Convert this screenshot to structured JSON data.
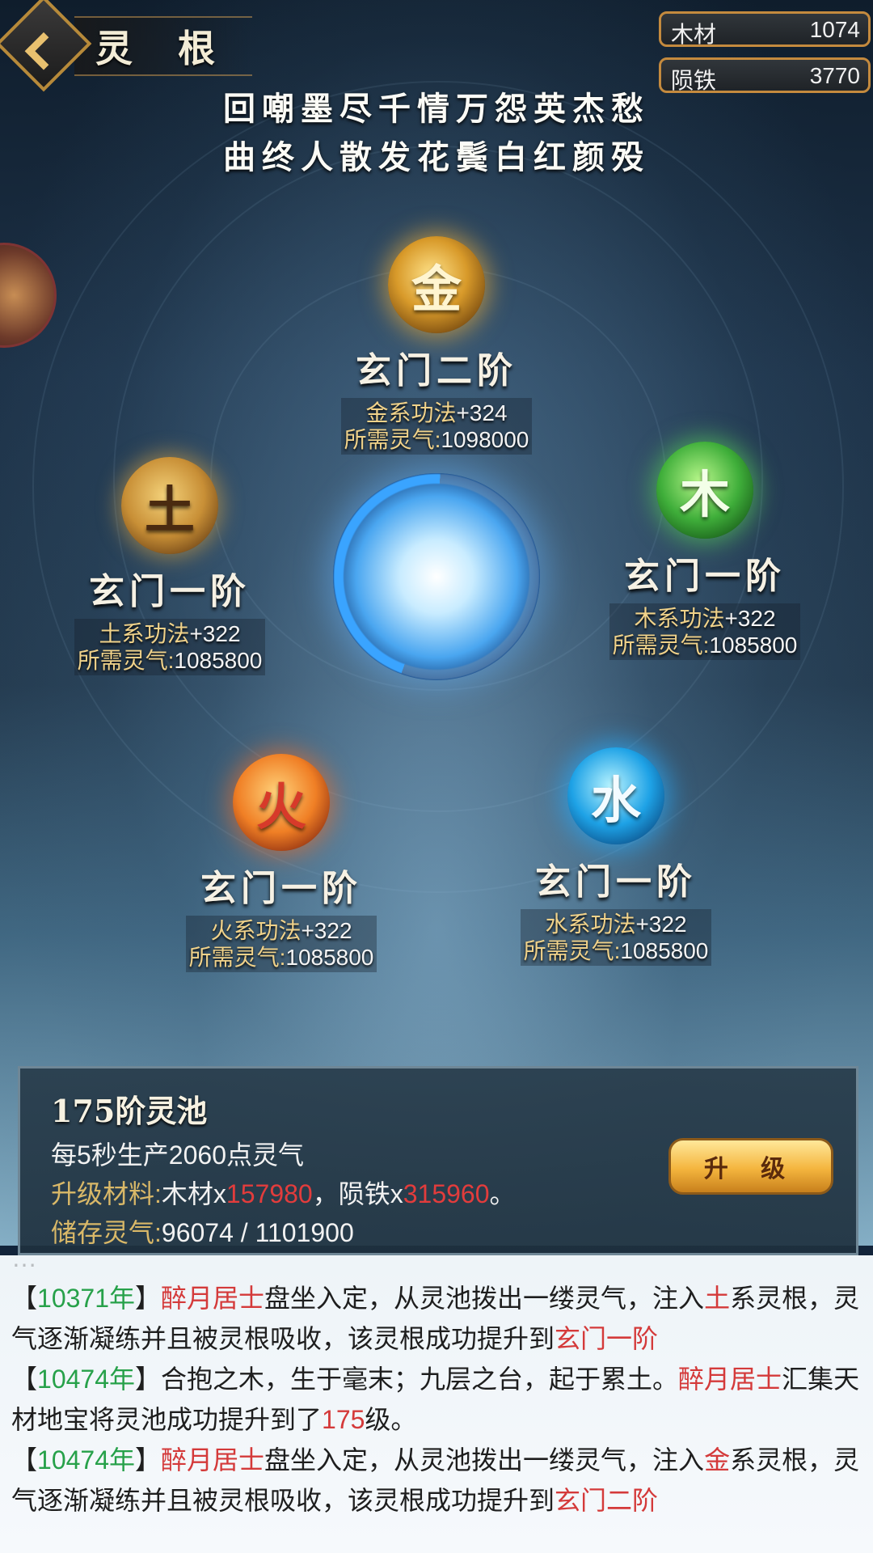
{
  "header": {
    "title": "灵 根"
  },
  "resources": [
    {
      "name": "木材",
      "value": "1074"
    },
    {
      "name": "陨铁",
      "value": "3770"
    }
  ],
  "poem": [
    "回嘲墨尽千情万怨英杰愁",
    "曲终人散发花鬓白红颜殁"
  ],
  "nodes": {
    "metal": {
      "glyph": "金",
      "rank": "玄门二阶",
      "stat_label": "金系功法",
      "stat_value": "+324",
      "req_label": "所需灵气:",
      "req_value": "1098000"
    },
    "earth": {
      "glyph": "土",
      "rank": "玄门一阶",
      "stat_label": "土系功法",
      "stat_value": "+322",
      "req_label": "所需灵气:",
      "req_value": "1085800"
    },
    "wood": {
      "glyph": "木",
      "rank": "玄门一阶",
      "stat_label": "木系功法",
      "stat_value": "+322",
      "req_label": "所需灵气:",
      "req_value": "1085800"
    },
    "fire": {
      "glyph": "火",
      "rank": "玄门一阶",
      "stat_label": "火系功法",
      "stat_value": "+322",
      "req_label": "所需灵气:",
      "req_value": "1085800"
    },
    "water": {
      "glyph": "水",
      "rank": "玄门一阶",
      "stat_label": "水系功法",
      "stat_value": "+322",
      "req_label": "所需灵气:",
      "req_value": "1085800"
    }
  },
  "core_progress": 0.45,
  "pool": {
    "title": "175阶灵池",
    "production": "每5秒生产2060点灵气",
    "material_label": "升级材料:",
    "material_wood_name": "木材x",
    "material_wood_amount": "157980",
    "material_sep": "，陨铁x",
    "material_iron_amount": "315960",
    "material_end": "。",
    "stored_label": "储存灵气:",
    "stored_current": "96074",
    "stored_sep": " / ",
    "stored_max": "1101900",
    "upgrade_label": "升 级"
  },
  "log": [
    {
      "open": "【",
      "year": "10371年",
      "close": "】",
      "actor": "醉月居士",
      "t1": "盘坐入定，从灵池拨出一缕灵气，注入",
      "element": "土",
      "t2": "系灵根，灵气逐渐凝练并且被灵根吸收，该灵根成功提升到",
      "result": "玄门一阶"
    },
    {
      "open": "【",
      "year": "10474年",
      "close": "】",
      "t1": "合抱之木，生于毫末；九层之台，起于累土。",
      "actor": "醉月居士",
      "t2": "汇集天材地宝将灵池成功提升到了",
      "level": "175",
      "t3": "级。"
    },
    {
      "open": "【",
      "year": "10474年",
      "close": "】",
      "actor": "醉月居士",
      "t1": "盘坐入定，从灵池拨出一缕灵气，注入",
      "element": "金",
      "t2": "系灵根，灵气逐渐凝练并且被灵根吸收，该灵根成功提升到",
      "result": "玄门二阶"
    }
  ]
}
